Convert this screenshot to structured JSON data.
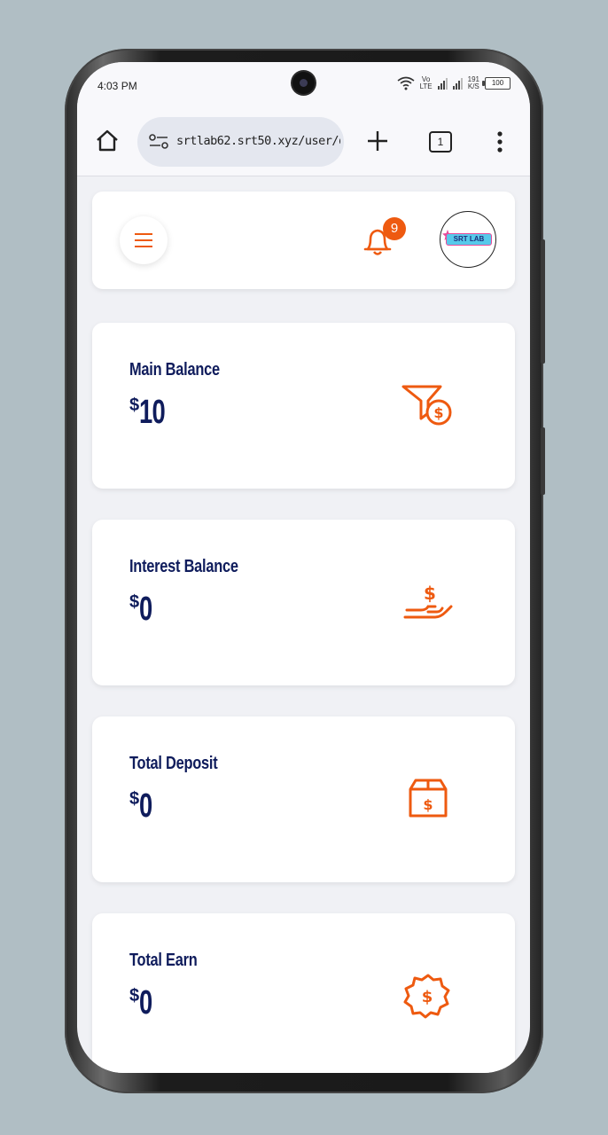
{
  "status_bar": {
    "time": "4:03 PM",
    "network_top": "Vo",
    "network_bottom": "LTE",
    "speed_top": "191",
    "speed_bottom": "K/S",
    "battery": "100"
  },
  "browser": {
    "url": "srtlab62.srt50.xyz/user/d",
    "tab_count": "1"
  },
  "header": {
    "notification_count": "9",
    "logo_text": "SRT LAB"
  },
  "cards": [
    {
      "label": "Main Balance",
      "currency": "$",
      "value": "10",
      "icon": "funnel-dollar-icon"
    },
    {
      "label": "Interest Balance",
      "currency": "$",
      "value": "0",
      "icon": "hand-dollar-icon"
    },
    {
      "label": "Total Deposit",
      "currency": "$",
      "value": "0",
      "icon": "box-dollar-icon"
    },
    {
      "label": "Total Earn",
      "currency": "$",
      "value": "0",
      "icon": "badge-dollar-icon"
    }
  ],
  "colors": {
    "accent": "#ee5a10",
    "text_primary": "#0f1c5c",
    "background": "#f0f1f5"
  }
}
